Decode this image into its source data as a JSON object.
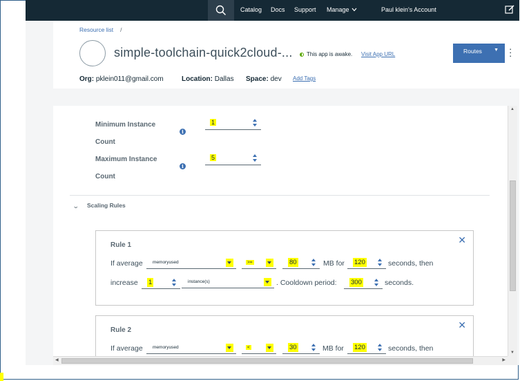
{
  "nav": {
    "items": [
      "Catalog",
      "Docs",
      "Support",
      "Manage"
    ],
    "account": "Paul klein's Account",
    "icons": {
      "search": "search-icon",
      "edit": "edit-icon",
      "manage_chevron": "chevron-down-icon"
    }
  },
  "header": {
    "breadcrumb": "Resource list",
    "breadcrumb_sep": "/",
    "app_title": "simple-toolchain-quick2cloud-...",
    "status": "This app is awake.",
    "visit_link": "Visit App URL",
    "routes_label": "Routes",
    "org_label": "Org:",
    "org_value": "pklein011@gmail.com",
    "location_label": "Location:",
    "location_value": "Dallas",
    "space_label": "Space:",
    "space_value": "dev",
    "add_tags": "Add Tags"
  },
  "instances": {
    "min_label_1": "Minimum Instance",
    "min_label_2": "Count",
    "min_value": "1",
    "max_label_1": "Maximum Instance",
    "max_label_2": "Count",
    "max_value": "5",
    "info_glyph": "i"
  },
  "scaling": {
    "title": "Scaling Rules",
    "rules": [
      {
        "title": "Rule 1",
        "if_text": "If average",
        "metric": "memoryused",
        "operator": ">=",
        "threshold": "80",
        "unit_text": "MB for",
        "duration": "120",
        "then_text": "seconds, then",
        "action": "increase",
        "step": "1",
        "step_unit": "instance(s)",
        "cooldown_text": ". Cooldown period:",
        "cooldown": "300",
        "seconds_text": "seconds."
      },
      {
        "title": "Rule 2",
        "if_text": "If average",
        "metric": "memoryused",
        "operator": "<",
        "threshold": "30",
        "unit_text": "MB for",
        "duration": "120",
        "then_text": "seconds, then"
      }
    ]
  },
  "colors": {
    "nav_bg": "#152935",
    "accent": "#3d70b2",
    "highlight": "#ffff00"
  }
}
